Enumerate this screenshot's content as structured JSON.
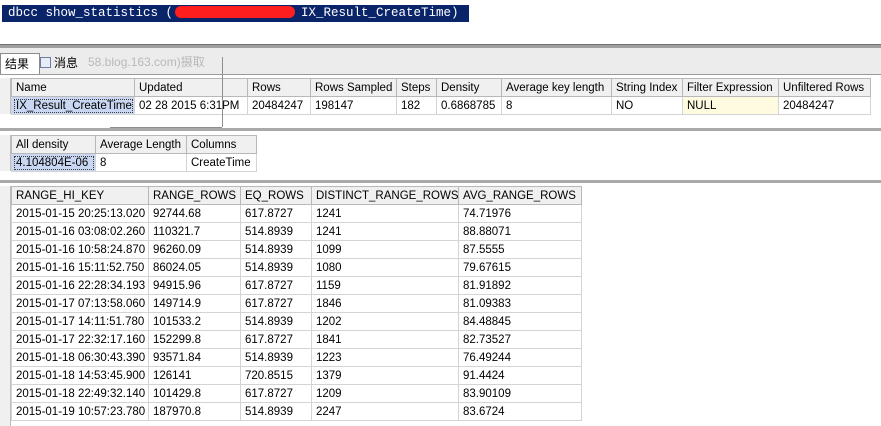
{
  "editor": {
    "query_prefix": "dbcc show_statistics (",
    "query_suffix": "IX_Result_CreateTime)"
  },
  "tabs": {
    "results_label": "结果",
    "messages_label": "消息",
    "watermark": "58.blog.163.com)摄取"
  },
  "header_grid": {
    "columns": [
      "Name",
      "Updated",
      "Rows",
      "Rows Sampled",
      "Steps",
      "Density",
      "Average key length",
      "String Index",
      "Filter Expression",
      "Unfiltered Rows"
    ],
    "row": [
      "IX_Result_CreateTime",
      "02 28 2015  6:31PM",
      "20484247",
      "198147",
      "182",
      "0.6868785",
      "8",
      "NO",
      "NULL",
      "20484247"
    ]
  },
  "density_grid": {
    "columns": [
      "All density",
      "Average Length",
      "Columns"
    ],
    "row": [
      "4.104804E-06",
      "8",
      "CreateTime"
    ]
  },
  "histogram_grid": {
    "columns": [
      "RANGE_HI_KEY",
      "RANGE_ROWS",
      "EQ_ROWS",
      "DISTINCT_RANGE_ROWS",
      "AVG_RANGE_ROWS"
    ],
    "rows": [
      [
        "2015-01-15 20:25:13.020",
        "92744.68",
        "617.8727",
        "1241",
        "74.71976"
      ],
      [
        "2015-01-16 03:08:02.260",
        "110321.7",
        "514.8939",
        "1241",
        "88.88071"
      ],
      [
        "2015-01-16 10:58:24.870",
        "96260.09",
        "514.8939",
        "1099",
        "87.5555"
      ],
      [
        "2015-01-16 15:11:52.750",
        "86024.05",
        "514.8939",
        "1080",
        "79.67615"
      ],
      [
        "2015-01-16 22:28:34.193",
        "94915.96",
        "617.8727",
        "1159",
        "81.91892"
      ],
      [
        "2015-01-17 07:13:58.060",
        "149714.9",
        "617.8727",
        "1846",
        "81.09383"
      ],
      [
        "2015-01-17 14:11:51.780",
        "101533.2",
        "514.8939",
        "1202",
        "84.48845"
      ],
      [
        "2015-01-17 22:32:17.160",
        "152299.8",
        "617.8727",
        "1841",
        "82.73527"
      ],
      [
        "2015-01-18 06:30:43.390",
        "93571.84",
        "514.8939",
        "1223",
        "76.49244"
      ],
      [
        "2015-01-18 14:53:45.900",
        "126141",
        "720.8515",
        "1379",
        "91.4424"
      ],
      [
        "2015-01-18 22:49:32.140",
        "101429.8",
        "617.8727",
        "1209",
        "83.90109"
      ],
      [
        "2015-01-19 10:57:23.780",
        "187970.8",
        "514.8939",
        "2247",
        "83.6724"
      ]
    ]
  }
}
